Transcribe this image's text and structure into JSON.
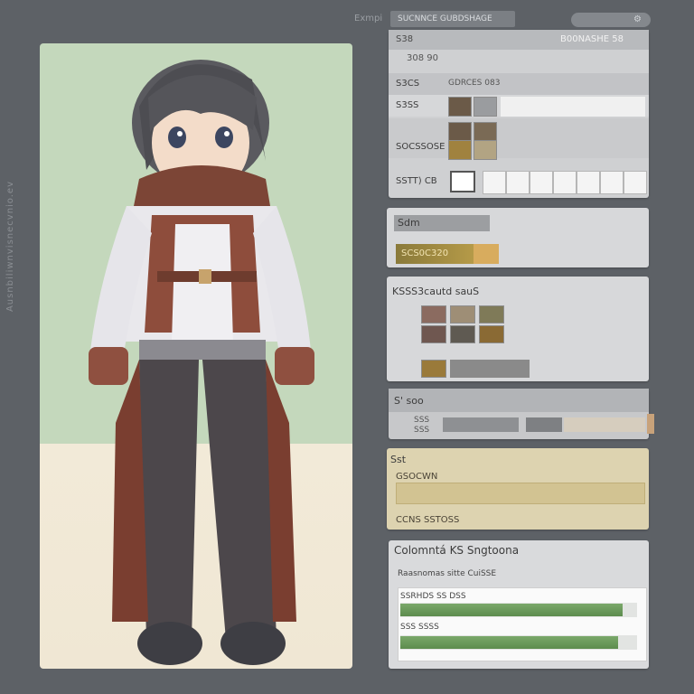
{
  "side_text": "Ausnbiliwnvisnecvnio.ev",
  "topbar": {
    "label": "Exmpi",
    "field": "SUCNNCE GUBDSHAGE",
    "icon": "gear-icon"
  },
  "inventory": {
    "title": "S38",
    "title_right": "B00NASHE 58",
    "sub": "308  90",
    "rows": [
      {
        "label": "S3CS",
        "tag": "GDRCES 083"
      },
      {
        "label": "S3SS"
      },
      {
        "label": "SOCSSOSE"
      },
      {
        "label": "SSTT) CB"
      }
    ]
  },
  "skills": {
    "title": "Sdm",
    "gold_value": "SCS0C320"
  },
  "equipment": {
    "title": "KSSS3cautd sauS"
  },
  "stats": {
    "title": "S' soo",
    "left_tag": "SSS",
    "left_value": "SSS"
  },
  "story": {
    "title": "Sst",
    "line1": "GSOCWN",
    "line2": "CCNS SSTOSS"
  },
  "compat": {
    "title": "Colomntá KS Sngtoona",
    "subtitle": "Raasnomas sitte CuiSSE",
    "bar1_label": "SSRHDS SS DSS",
    "bar2_label": "SSS SSSS",
    "bar1_level": 0.94,
    "bar2_level": 0.92
  },
  "colors": {
    "background": "#5d6166",
    "panel": "#d7d8da",
    "accent_green": "#6b9a5c",
    "accent_gold": "#b59a48"
  }
}
